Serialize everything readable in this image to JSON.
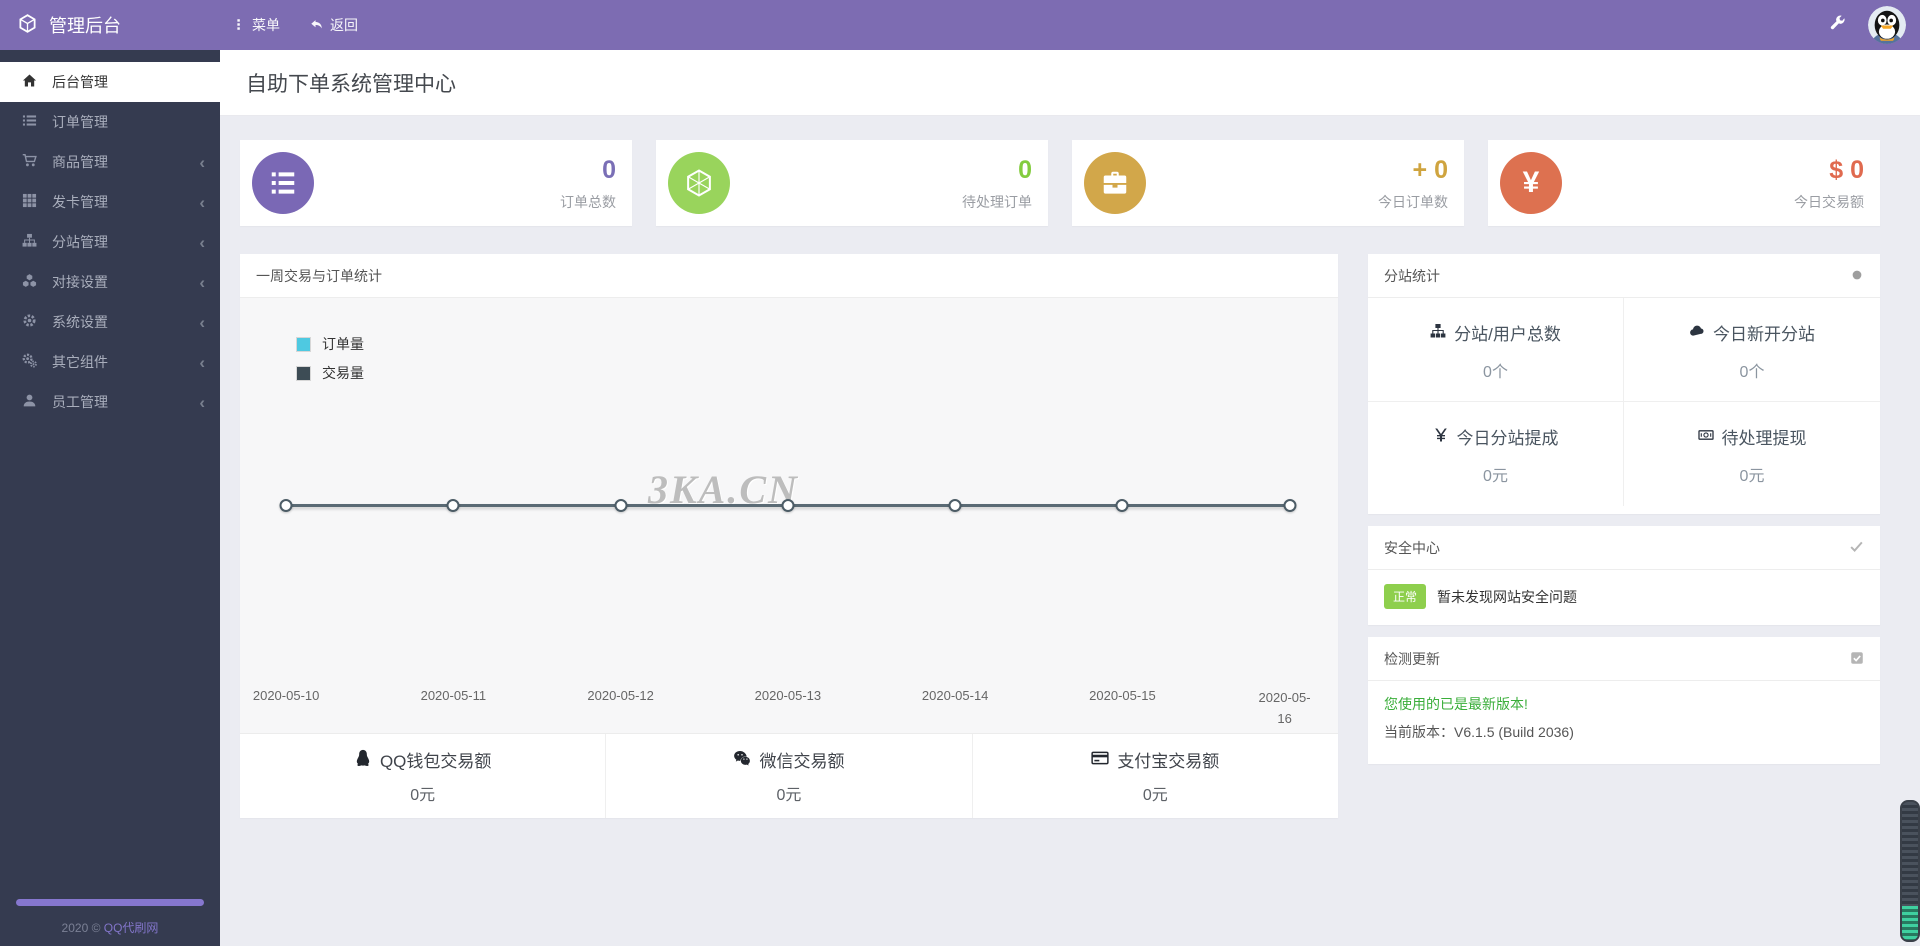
{
  "topbar": {
    "brand": "管理后台",
    "menu": "菜单",
    "back": "返回",
    "icons": {
      "brand": "cube-icon",
      "menu": "vertical-dots-icon",
      "back": "reply-arrow-icon",
      "right": [
        "wrench-icon",
        "qq-avatar"
      ]
    }
  },
  "sidebar": {
    "items": [
      {
        "label": "后台管理",
        "icon": "home",
        "active": true,
        "chevron": false
      },
      {
        "label": "订单管理",
        "icon": "list",
        "active": false,
        "chevron": false
      },
      {
        "label": "商品管理",
        "icon": "cart",
        "active": false,
        "chevron": true
      },
      {
        "label": "发卡管理",
        "icon": "grid",
        "active": false,
        "chevron": true
      },
      {
        "label": "分站管理",
        "icon": "sitemap",
        "active": false,
        "chevron": true
      },
      {
        "label": "对接设置",
        "icon": "cubes",
        "active": false,
        "chevron": true
      },
      {
        "label": "系统设置",
        "icon": "gear",
        "active": false,
        "chevron": true
      },
      {
        "label": "其它组件",
        "icon": "cogs",
        "active": false,
        "chevron": true
      },
      {
        "label": "员工管理",
        "icon": "user",
        "active": false,
        "chevron": true
      }
    ],
    "footer_year": "2020 ©",
    "footer_link": "QQ代刷网"
  },
  "page": {
    "title": "自助下单系统管理中心"
  },
  "stat_cards": [
    {
      "value": "0",
      "label": "订单总数",
      "icon": "list-ol",
      "glyph": "",
      "circle_color": "#7a68b5",
      "value_color": "#7a6fb6"
    },
    {
      "value": "0",
      "label": "待处理订单",
      "icon": "hexagon",
      "glyph": "",
      "circle_color": "#99d45c",
      "value_color": "#83cc3f"
    },
    {
      "value": "+ 0",
      "label": "今日订单数",
      "icon": "briefcase",
      "glyph": "",
      "circle_color": "#d2a74a",
      "value_color": "#cfa43f"
    },
    {
      "value": "$ 0",
      "label": "今日交易额",
      "icon": "yen-sign",
      "glyph": "¥",
      "circle_color": "#dd7150",
      "value_color": "#e06a4f"
    }
  ],
  "chart_data": {
    "type": "line",
    "title": "一周交易与订单统计",
    "watermark": "3KA.CN",
    "x": [
      "2020-05-10",
      "2020-05-11",
      "2020-05-12",
      "2020-05-13",
      "2020-05-14",
      "2020-05-15",
      "2020-05-16"
    ],
    "series": [
      {
        "name": "订单量",
        "values": [
          0,
          0,
          0,
          0,
          0,
          0,
          0
        ],
        "color": "#4ec9e1"
      },
      {
        "name": "交易量",
        "values": [
          0,
          0,
          0,
          0,
          0,
          0,
          0
        ],
        "color": "#3d4c55"
      }
    ],
    "legend_position": "top-left",
    "grid": false,
    "line_color": "#5a6a74"
  },
  "payment_stats": [
    {
      "label": "QQ钱包交易额",
      "value": "0元",
      "icon": "qq"
    },
    {
      "label": "微信交易额",
      "value": "0元",
      "icon": "wechat"
    },
    {
      "label": "支付宝交易额",
      "value": "0元",
      "icon": "credit-card"
    }
  ],
  "substation_panel": {
    "title": "分站统计",
    "header_icon": "dot-icon",
    "cells": [
      {
        "label": "分站/用户总数",
        "value": "0个",
        "icon": "sitemap"
      },
      {
        "label": "今日新开分站",
        "value": "0个",
        "icon": "cloud"
      },
      {
        "label": "今日分站提成",
        "value": "0元",
        "icon": "yen",
        "glyph": "¥"
      },
      {
        "label": "待处理提现",
        "value": "0元",
        "icon": "money"
      }
    ]
  },
  "security_panel": {
    "title": "安全中心",
    "header_icon": "check-icon",
    "badge": "正常",
    "badge_color": "#8ecf4d",
    "message": "暂未发现网站安全问题"
  },
  "update_panel": {
    "title": "检测更新",
    "header_icon": "checked-box-icon",
    "status": "您使用的已是最新版本!",
    "status_color": "#3aae3a",
    "version": "当前版本：V6.1.5 (Build 2036)"
  }
}
